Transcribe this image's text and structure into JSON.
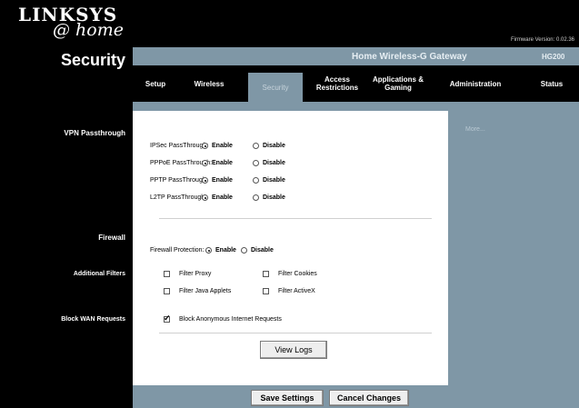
{
  "brand": {
    "logo_text": "LINKSYS",
    "logo_sub": "@ home"
  },
  "firmware": "Firmware Version: 0.02.36",
  "product": {
    "name": "Home Wireless-G Gateway",
    "model": "HG200"
  },
  "section_title": "Security",
  "tabs": [
    {
      "label": "Setup",
      "active": false
    },
    {
      "label": "Wireless",
      "active": false
    },
    {
      "label": "Security",
      "active": true
    },
    {
      "label": "Access Restrictions",
      "active": false
    },
    {
      "label": "Applications & Gaming",
      "active": false
    },
    {
      "label": "Administration",
      "active": false
    },
    {
      "label": "Status",
      "active": false
    }
  ],
  "side_help": {
    "more_label": "More..."
  },
  "vpn": {
    "section_label": "VPN Passthrough",
    "rows": [
      {
        "label": "IPSec PassThrough:",
        "enable": "Enable",
        "disable": "Disable",
        "value": "enable"
      },
      {
        "label": "PPPoE PassThrough:",
        "enable": "Enable",
        "disable": "Disable",
        "value": "enable"
      },
      {
        "label": "PPTP PassThrough:",
        "enable": "Enable",
        "disable": "Disable",
        "value": "enable"
      },
      {
        "label": "L2TP PassThrough:",
        "enable": "Enable",
        "disable": "Disable",
        "value": "enable"
      }
    ]
  },
  "firewall": {
    "section_label": "Firewall",
    "protection_label": "Firewall Protection:",
    "enable": "Enable",
    "disable": "Disable",
    "value": "enable"
  },
  "filters": {
    "section_label": "Additional Filters",
    "items": [
      {
        "label": "Filter Proxy",
        "checked": false
      },
      {
        "label": "Filter Cookies",
        "checked": false
      },
      {
        "label": "Filter Java Applets",
        "checked": false
      },
      {
        "label": "Filter ActiveX",
        "checked": false
      }
    ]
  },
  "wan": {
    "section_label": "Block WAN Requests",
    "item_label": "Block Anonymous Internet Requests",
    "checked": true
  },
  "buttons": {
    "view_logs": "View Logs",
    "save": "Save Settings",
    "cancel": "Cancel Changes"
  },
  "colors": {
    "band": "#7f97a6",
    "black": "#000000"
  }
}
